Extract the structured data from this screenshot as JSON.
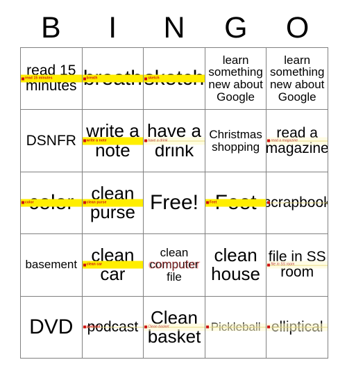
{
  "header": {
    "letters": [
      "B",
      "I",
      "N",
      "G",
      "O"
    ]
  },
  "colors": {
    "daub_strong": "#ffee00",
    "daub_pale": "#fffde0",
    "daub_label": "#cc1111",
    "grid_line": "#808080",
    "text": "#000000"
  },
  "grid": {
    "rows": [
      [
        {
          "text": "read 15 minutes",
          "size": "fs-md",
          "daub": "strong",
          "daub_label": "read 15 minutes"
        },
        {
          "text": "breath",
          "size": "fs-xl",
          "daub": "strong",
          "daub_label": "breath"
        },
        {
          "text": "sketch",
          "size": "fs-xl",
          "daub": "strong",
          "daub_label": "sketch"
        },
        {
          "text": "learn something new about Google",
          "size": "fs-sm",
          "daub": "none",
          "daub_label": ""
        },
        {
          "text": "learn something new about Google",
          "size": "fs-sm",
          "daub": "none",
          "daub_label": ""
        }
      ],
      [
        {
          "text": "DSNFR",
          "size": "fs-md",
          "daub": "none",
          "daub_label": ""
        },
        {
          "text": "write a note",
          "size": "fs-lg",
          "daub": "strong",
          "daub_label": "write a note"
        },
        {
          "text": "have a drink",
          "size": "fs-lg",
          "daub": "pale",
          "daub_label": "have a drink"
        },
        {
          "text": "Christmas shopping",
          "size": "fs-sm",
          "daub": "none",
          "daub_label": ""
        },
        {
          "text": "read a magazine",
          "size": "fs-md",
          "daub": "faint",
          "daub_label": "read a magazine"
        }
      ],
      [
        {
          "text": "color",
          "size": "fs-xl",
          "daub": "strong",
          "daub_label": "color"
        },
        {
          "text": "clean purse",
          "size": "fs-lg",
          "daub": "strong",
          "daub_label": "clean purse"
        },
        {
          "text": "Free!",
          "size": "fs-xl",
          "daub": "none",
          "daub_label": ""
        },
        {
          "text": "Feet",
          "size": "fs-xl",
          "daub": "strong",
          "daub_label": "Feet"
        },
        {
          "text": "scrapbook",
          "size": "fs-md",
          "daub": "white",
          "daub_label": ""
        }
      ],
      [
        {
          "text": "basement",
          "size": "fs-sm",
          "daub": "none",
          "daub_label": ""
        },
        {
          "text": "clean car",
          "size": "fs-lg",
          "daub": "strong",
          "daub_label": "clean car"
        },
        {
          "text": "clean computer file",
          "size": "fs-sm",
          "daub": "none",
          "daub_label": "",
          "overlay_word": "computer"
        },
        {
          "text": "clean house",
          "size": "fs-lg",
          "daub": "none",
          "daub_label": ""
        },
        {
          "text": "file in SS room",
          "size": "fs-md",
          "daub": "faint",
          "daub_label": "file in SS room"
        }
      ],
      [
        {
          "text": "DVD",
          "size": "fs-xl",
          "daub": "none",
          "daub_label": ""
        },
        {
          "text": "podcast",
          "size": "fs-md",
          "daub": "white",
          "daub_label": "podcast"
        },
        {
          "text": "Clean basket",
          "size": "fs-lg",
          "daub": "faint",
          "daub_label": "Clean basket"
        },
        {
          "text": "Pickleball",
          "size": "fs-sm",
          "daub": "faint",
          "daub_label": ""
        },
        {
          "text": "elliptical",
          "size": "fs-md",
          "daub": "faint",
          "daub_label": ""
        }
      ]
    ]
  }
}
